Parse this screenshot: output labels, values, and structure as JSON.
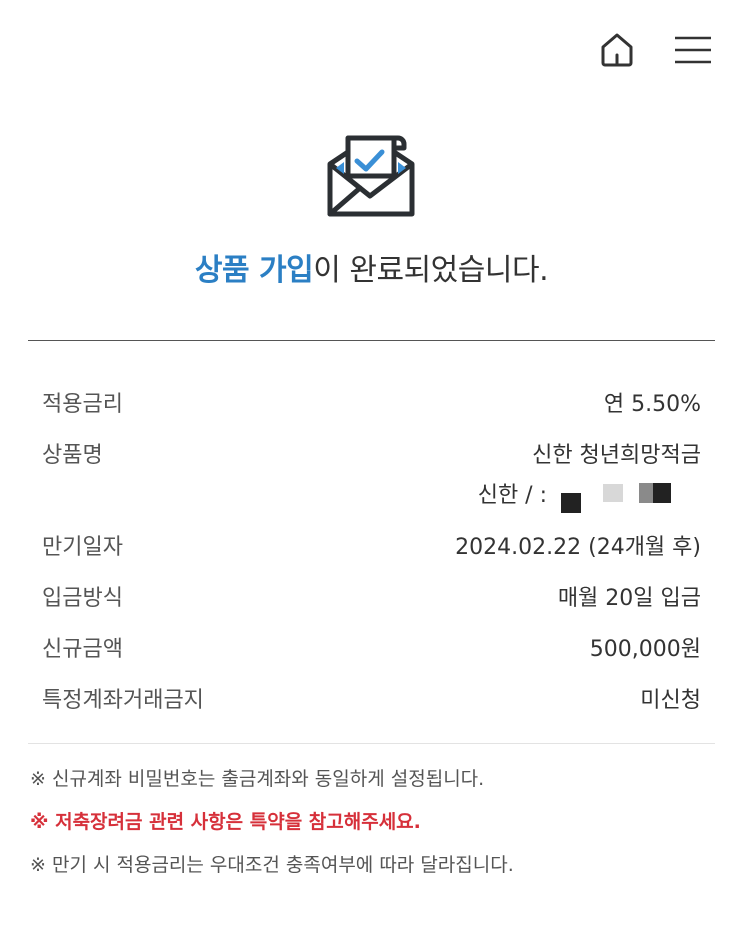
{
  "header": {
    "home_icon": "home-icon",
    "menu_icon": "hamburger-menu-icon"
  },
  "hero": {
    "icon": "envelope-check-icon",
    "title_accent": "상품 가입",
    "title_rest": "이 완료되었습니다.",
    "colors": {
      "accent": "#2b7fc4",
      "icon_dark": "#2b2f33",
      "icon_blue": "#3a8fd6"
    }
  },
  "details": {
    "rows": [
      {
        "label": "적용금리",
        "value": "연 5.50%"
      },
      {
        "label": "상품명",
        "value": "신한 청년희망적금",
        "sub_value": "신한 / :"
      },
      {
        "label": "만기일자",
        "value": "2024.02.22 (24개월 후)"
      },
      {
        "label": "입금방식",
        "value": "매월 20일 입금"
      },
      {
        "label": "신규금액",
        "value": "500,000원"
      },
      {
        "label": "특정계좌거래금지",
        "value": "미신청"
      }
    ]
  },
  "notes": [
    {
      "text": "※ 신규계좌 비밀번호는 출금계좌와 동일하게 설정됩니다.",
      "style": "normal"
    },
    {
      "text": "※ 저축장려금 관련 사항은 특약을 참고해주세요.",
      "style": "warn",
      "color": "#d6303a"
    },
    {
      "text": "※ 만기 시 적용금리는 우대조건 충족여부에 따라 달라집니다.",
      "style": "normal"
    }
  ]
}
